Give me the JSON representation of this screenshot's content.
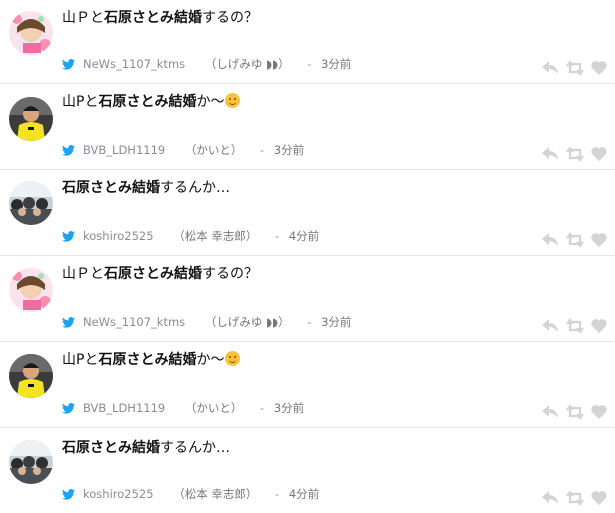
{
  "tweets": [
    {
      "text_pre": "山Ｐと",
      "text_bold": "石原さとみ結婚",
      "text_post": "するの？",
      "emoji": "",
      "username": "NeWs_1107_ktms",
      "display_name": "（しげみゆ ◗◗）",
      "time": "3分前",
      "avatar": "pink-flower-avatar"
    },
    {
      "text_pre": "山Pと",
      "text_bold": "石原さとみ結婚",
      "text_post": "か〜",
      "emoji": "smiling-face",
      "username": "BVB_LDH1119",
      "display_name": "（かいと）",
      "time": "3分前",
      "avatar": "yellow-jersey-avatar"
    },
    {
      "text_pre": "",
      "text_bold": "石原さとみ結婚",
      "text_post": "するんか…",
      "emoji": "",
      "username": "koshiro2525",
      "display_name": "（松本 幸志郎）",
      "time": "4分前",
      "avatar": "crowd-photo-avatar"
    },
    {
      "text_pre": "山Ｐと",
      "text_bold": "石原さとみ結婚",
      "text_post": "するの？",
      "emoji": "",
      "username": "NeWs_1107_ktms",
      "display_name": "（しげみゆ ◗◗）",
      "time": "3分前",
      "avatar": "pink-flower-avatar"
    },
    {
      "text_pre": "山Pと",
      "text_bold": "石原さとみ結婚",
      "text_post": "か〜",
      "emoji": "smiling-face",
      "username": "BVB_LDH1119",
      "display_name": "（かいと）",
      "time": "3分前",
      "avatar": "yellow-jersey-avatar"
    },
    {
      "text_pre": "",
      "text_bold": "石原さとみ結婚",
      "text_post": "するんか…",
      "emoji": "",
      "username": "koshiro2525",
      "display_name": "（松本 幸志郎）",
      "time": "4分前",
      "avatar": "crowd-photo-avatar"
    }
  ],
  "separator": "-",
  "colors": {
    "twitter_blue": "#1da1f2",
    "action_gray": "#d4d4d4",
    "meta_gray": "#8a8a9a",
    "divider": "#e6e6e6"
  },
  "icons": [
    "twitter-bird-icon",
    "reply-icon",
    "retweet-icon",
    "like-heart-icon"
  ]
}
